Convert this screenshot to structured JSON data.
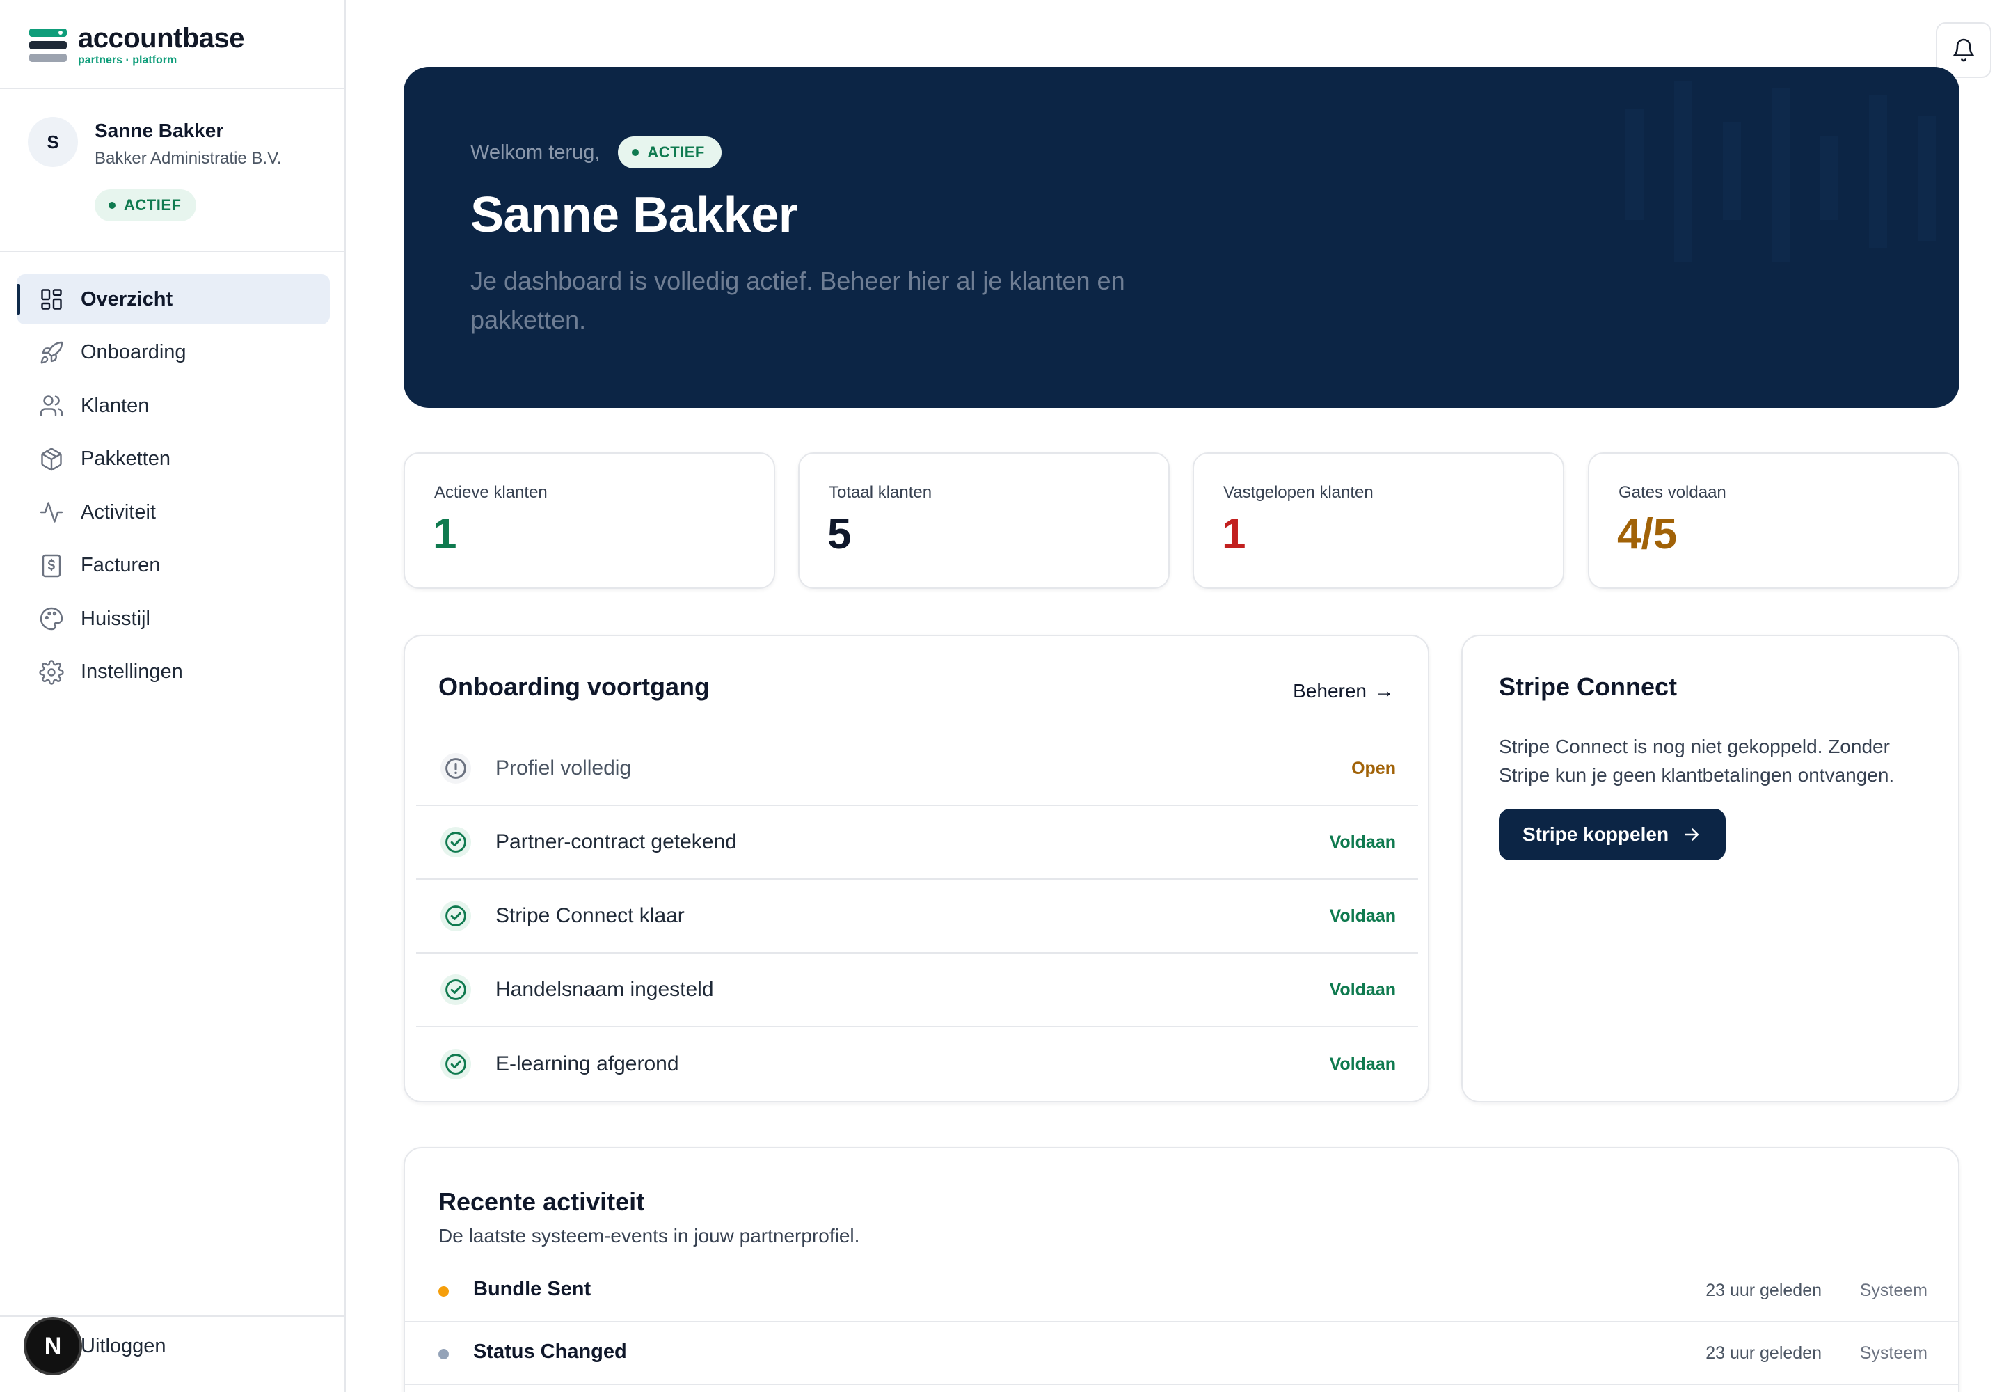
{
  "brand": {
    "name": "accountbase",
    "tagline": "partners · platform"
  },
  "profile": {
    "initial": "S",
    "name": "Sanne Bakker",
    "company": "Bakker Administratie B.V.",
    "status": "ACTIEF"
  },
  "nav": [
    {
      "label": "Overzicht",
      "icon": "grid-icon",
      "active": true
    },
    {
      "label": "Onboarding",
      "icon": "rocket-icon"
    },
    {
      "label": "Klanten",
      "icon": "users-icon"
    },
    {
      "label": "Pakketten",
      "icon": "package-icon"
    },
    {
      "label": "Activiteit",
      "icon": "activity-icon"
    },
    {
      "label": "Facturen",
      "icon": "invoice-icon"
    },
    {
      "label": "Huisstijl",
      "icon": "palette-icon"
    },
    {
      "label": "Instellingen",
      "icon": "gear-icon"
    }
  ],
  "logout": {
    "label": "Uitloggen",
    "badge": "N"
  },
  "hero": {
    "welcome": "Welkom terug,",
    "badge": "ACTIEF",
    "title": "Sanne Bakker",
    "subtitle": "Je dashboard is volledig actief. Beheer hier al je klanten en pakketten."
  },
  "stats": [
    {
      "label": "Actieve klanten",
      "value": "1",
      "color": "#0f7a4f"
    },
    {
      "label": "Totaal klanten",
      "value": "5",
      "color": "#0f172a"
    },
    {
      "label": "Vastgelopen klanten",
      "value": "1",
      "color": "#c2201f"
    },
    {
      "label": "Gates voldaan",
      "value": "4/5",
      "color": "#a16207"
    }
  ],
  "onboarding": {
    "title": "Onboarding voortgang",
    "manage": "Beheren",
    "manage_arrow": "→",
    "steps": [
      {
        "label": "Profiel volledig",
        "status": "Open",
        "done": false
      },
      {
        "label": "Partner-contract getekend",
        "status": "Voldaan",
        "done": true
      },
      {
        "label": "Stripe Connect klaar",
        "status": "Voldaan",
        "done": true
      },
      {
        "label": "Handelsnaam ingesteld",
        "status": "Voldaan",
        "done": true
      },
      {
        "label": "E-learning afgerond",
        "status": "Voldaan",
        "done": true
      }
    ]
  },
  "stripe": {
    "title": "Stripe Connect",
    "text": "Stripe Connect is nog niet gekoppeld. Zonder Stripe kun je geen klantbetalingen ontvangen.",
    "button": "Stripe koppelen"
  },
  "activity": {
    "title": "Recente activiteit",
    "subtitle": "De laatste systeem-events in jouw partnerprofiel.",
    "rows": [
      {
        "label": "Bundle Sent",
        "time": "23 uur geleden",
        "source": "Systeem",
        "dot": "#f59e0b"
      },
      {
        "label": "Status Changed",
        "time": "23 uur geleden",
        "source": "Systeem",
        "dot": "#94a3b8"
      }
    ]
  },
  "colors": {
    "navy": "#0c2545",
    "green": "#0f7a4f",
    "amber": "#a16207",
    "red": "#c2201f"
  }
}
